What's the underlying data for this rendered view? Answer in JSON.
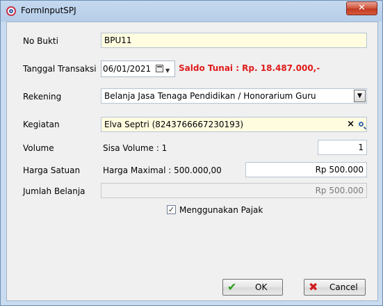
{
  "window": {
    "title": "FormInputSPJ",
    "close_label": "✕"
  },
  "form": {
    "no_bukti": {
      "label": "No Bukti",
      "value": "BPU11"
    },
    "tanggal": {
      "label": "Tanggal Transaksi",
      "value": "06/01/2021"
    },
    "saldo_text": "Saldo Tunai : Rp. 18.487.000,-",
    "rekening": {
      "label": "Rekening",
      "value": "Belanja Jasa Tenaga Pendidikan / Honorarium Guru"
    },
    "kegiatan": {
      "label": "Kegiatan",
      "value": "Elva Septri (8243766667230193)"
    },
    "volume": {
      "label": "Volume",
      "info": "Sisa Volume : 1",
      "value": "1"
    },
    "harga": {
      "label": "Harga Satuan",
      "info": "Harga Maximal : 500.000,00",
      "value": "Rp 500.000"
    },
    "jumlah": {
      "label": "Jumlah Belanja",
      "value": "Rp 500.000"
    },
    "pajak": {
      "label": "Menggunakan Pajak",
      "checked": true,
      "check_glyph": "✓"
    }
  },
  "buttons": {
    "ok": "OK",
    "cancel": "Cancel",
    "ok_icon": "✔",
    "cancel_icon": "✖"
  },
  "colors": {
    "saldo": "#e01b1b",
    "input_highlight": "#fffce0"
  }
}
